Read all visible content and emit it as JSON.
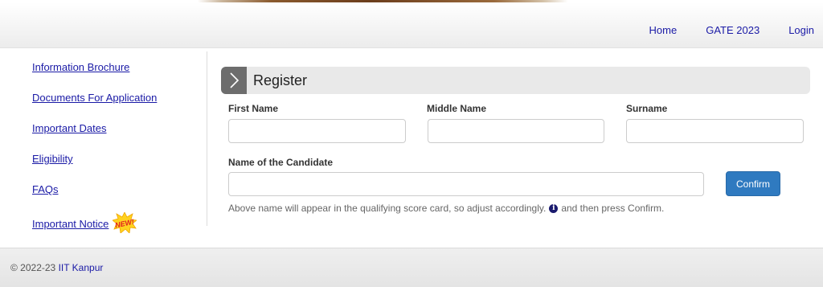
{
  "header": {
    "nav": [
      "Home",
      "GATE 2023",
      "Login"
    ]
  },
  "sidebar": {
    "items": [
      "Information Brochure",
      "Documents For Application",
      "Important Dates",
      "Eligibility",
      "FAQs",
      "Important Notice"
    ],
    "new_badge": "NEW!"
  },
  "register": {
    "title": "Register",
    "first_name_label": "First Name",
    "middle_name_label": "Middle Name",
    "surname_label": "Surname",
    "candidate_name_label": "Name of the Candidate",
    "first_name_value": "",
    "middle_name_value": "",
    "surname_value": "",
    "candidate_name_value": "",
    "confirm_label": "Confirm",
    "note_before": "Above name will appear in the qualifying score card, so adjust accordingly.",
    "note_after": "and then press Confirm.",
    "info_icon": "info-icon"
  },
  "footer": {
    "copyright": "© 2022-23",
    "org": "IIT Kanpur"
  },
  "colors": {
    "link": "#1a1aa6",
    "button": "#2f7ac0",
    "badge_red": "#e02020",
    "badge_yellow": "#ffd21f"
  }
}
